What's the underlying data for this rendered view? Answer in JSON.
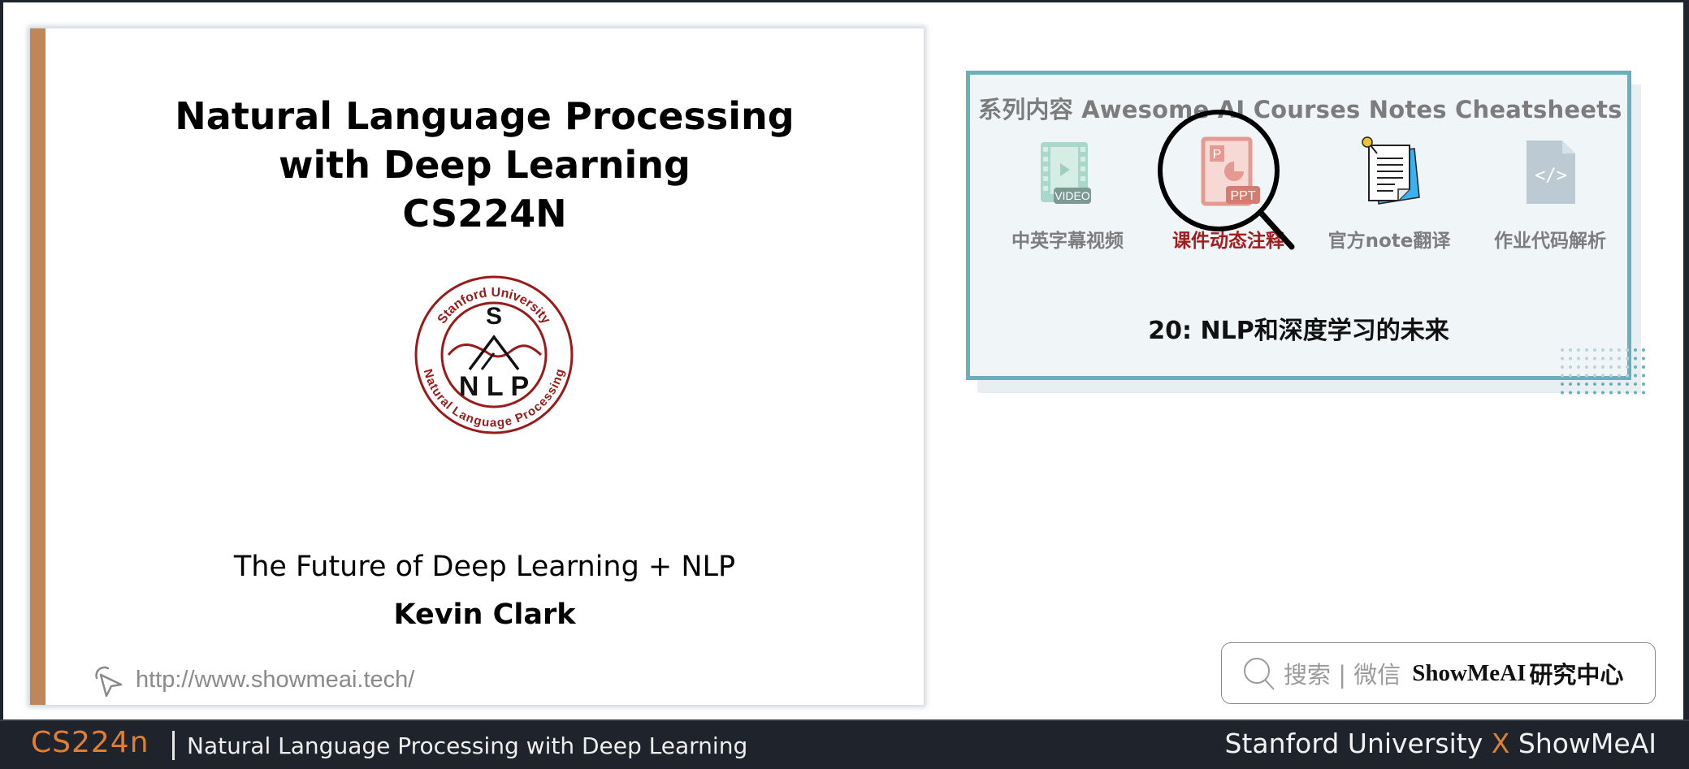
{
  "slide": {
    "title_lines": [
      "Natural Language Processing",
      "with Deep Learning",
      "CS224N"
    ],
    "logo": {
      "top_text": "Stanford University",
      "bottom_text": "Natural Language Processing",
      "letter_top": "S",
      "letters_bottom": "N L P",
      "icon": "stanford-nlp-logo"
    },
    "subtitle": "The Future of Deep Learning + NLP",
    "author": "Kevin Clark",
    "url": "http://www.showmeai.tech/",
    "url_icon": "cursor-click-icon",
    "accent_color": "#bf8657"
  },
  "series_card": {
    "heading": "系列内容 Awesome AI Courses Notes Cheatsheets",
    "items": [
      {
        "label": "中英字幕视频",
        "icon": "video-icon",
        "badge": "VIDEO",
        "active": false
      },
      {
        "label": "课件动态注释",
        "icon": "ppt-icon",
        "badge": "PPT",
        "active": true
      },
      {
        "label": "官方note翻译",
        "icon": "note-document-icon",
        "badge": "",
        "active": false
      },
      {
        "label": "作业代码解析",
        "icon": "code-file-icon",
        "badge": "</>",
        "active": false
      }
    ],
    "lecture_title": "20: NLP和深度学习的未来",
    "border_color": "#6aafbe",
    "active_color": "#a51c1c"
  },
  "search_box": {
    "hint": "搜索 | 微信",
    "brand": "ShowMeAI",
    "brand_suffix": "研究中心",
    "icon": "search-icon"
  },
  "bottom_bar": {
    "course_code": "CS224n",
    "course_name": "Natural Language Processing with Deep Learning",
    "right_left": "Stanford University",
    "right_x": "X",
    "right_right": "ShowMeAI",
    "accent_color": "#e07f31"
  }
}
